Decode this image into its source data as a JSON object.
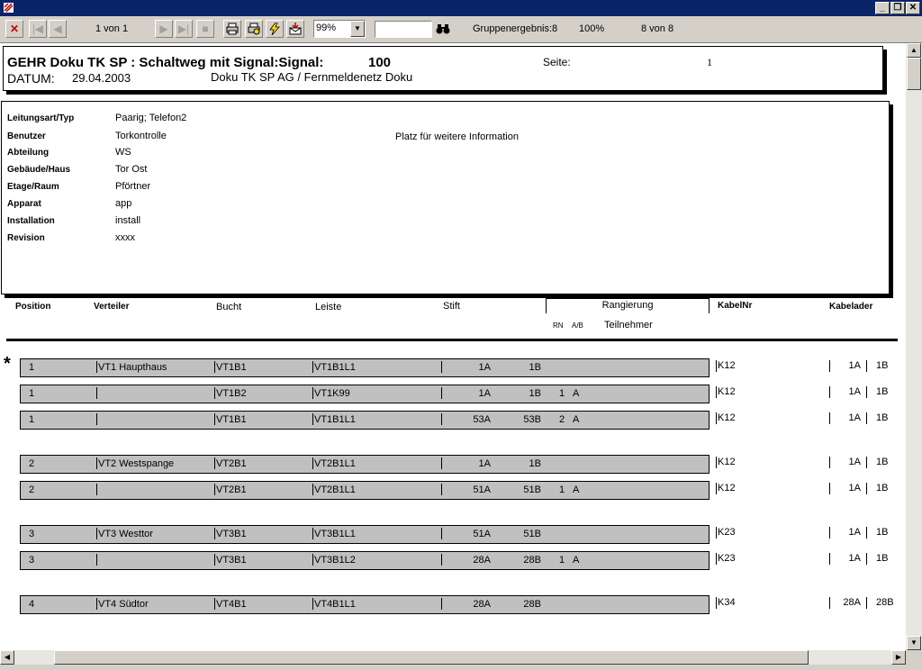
{
  "toolbar": {
    "page_info": "1 von 1",
    "zoom": "99%",
    "search_value": "",
    "group_result": "Gruppenergebnis:8",
    "percent": "100%",
    "count": "8 von 8"
  },
  "report": {
    "title": "GEHR Doku TK SP : Schaltweg mit Signal:Signal:",
    "signal_no": "100",
    "page_label": "Seite:",
    "page_no": "1",
    "date_label": "DATUM:",
    "date": "29.04.2003",
    "company": "Doku TK SP AG / Fernmeldenetz Doku"
  },
  "info": {
    "placeholder": "Platz für weitere Information",
    "fields": [
      {
        "label": "Leitungsart/Typ",
        "value": "Paarig; Telefon2"
      },
      {
        "label": "Benutzer",
        "value": "Torkontrolle"
      },
      {
        "label": "Abteilung",
        "value": "WS"
      },
      {
        "label": "Gebäude/Haus",
        "value": "Tor Ost"
      },
      {
        "label": "Etage/Raum",
        "value": "Pförtner"
      },
      {
        "label": "Apparat",
        "value": "app"
      },
      {
        "label": "Installation",
        "value": "install"
      },
      {
        "label": "Revision",
        "value": "xxxx"
      }
    ]
  },
  "columns": {
    "position": "Position",
    "verteiler": "Verteiler",
    "bucht": "Bucht",
    "leiste": "Leiste",
    "stift": "Stift",
    "rangierung": "Rangierung",
    "rn": "RN",
    "ab": "A/B",
    "teilnehmer": "Teilnehmer",
    "kabelnr": "KabelNr",
    "kabelader": "Kabelader"
  },
  "rows": [
    {
      "marker": "*",
      "pos": "1",
      "verteiler": "VT1 Haupthaus",
      "bucht": "VT1B1",
      "leiste": "VT1B1L1",
      "stift": "1A",
      "rang": "1B",
      "rn": "",
      "ab": "",
      "kabel": "K12",
      "ader1": "1A",
      "ader2": "1B"
    },
    {
      "marker": "",
      "pos": "1",
      "verteiler": "",
      "bucht": "VT1B2",
      "leiste": "VT1K99",
      "stift": "1A",
      "rang": "1B",
      "rn": "1",
      "ab": "A",
      "kabel": "K12",
      "ader1": "1A",
      "ader2": "1B"
    },
    {
      "marker": "",
      "pos": "1",
      "verteiler": "",
      "bucht": "VT1B1",
      "leiste": "VT1B1L1",
      "stift": "53A",
      "rang": "53B",
      "rn": "2",
      "ab": "A",
      "kabel": "K12",
      "ader1": "1A",
      "ader2": "1B"
    },
    {
      "marker": "",
      "pos": "2",
      "verteiler": "VT2 Westspange",
      "bucht": "VT2B1",
      "leiste": "VT2B1L1",
      "stift": "1A",
      "rang": "1B",
      "rn": "",
      "ab": "",
      "kabel": "K12",
      "ader1": "1A",
      "ader2": "1B"
    },
    {
      "marker": "",
      "pos": "2",
      "verteiler": "",
      "bucht": "VT2B1",
      "leiste": "VT2B1L1",
      "stift": "51A",
      "rang": "51B",
      "rn": "1",
      "ab": "A",
      "kabel": "K12",
      "ader1": "1A",
      "ader2": "1B"
    },
    {
      "marker": "",
      "pos": "3",
      "verteiler": "VT3 Westtor",
      "bucht": "VT3B1",
      "leiste": "VT3B1L1",
      "stift": "51A",
      "rang": "51B",
      "rn": "",
      "ab": "",
      "kabel": "K23",
      "ader1": "1A",
      "ader2": "1B"
    },
    {
      "marker": "",
      "pos": "3",
      "verteiler": "",
      "bucht": "VT3B1",
      "leiste": "VT3B1L2",
      "stift": "28A",
      "rang": "28B",
      "rn": "1",
      "ab": "A",
      "kabel": "K23",
      "ader1": "1A",
      "ader2": "1B"
    },
    {
      "marker": "",
      "pos": "4",
      "verteiler": "VT4 Südtor",
      "bucht": "VT4B1",
      "leiste": "VT4B1L1",
      "stift": "28A",
      "rang": "28B",
      "rn": "",
      "ab": "",
      "kabel": "K34",
      "ader1": "28A",
      "ader2": "28B"
    }
  ]
}
